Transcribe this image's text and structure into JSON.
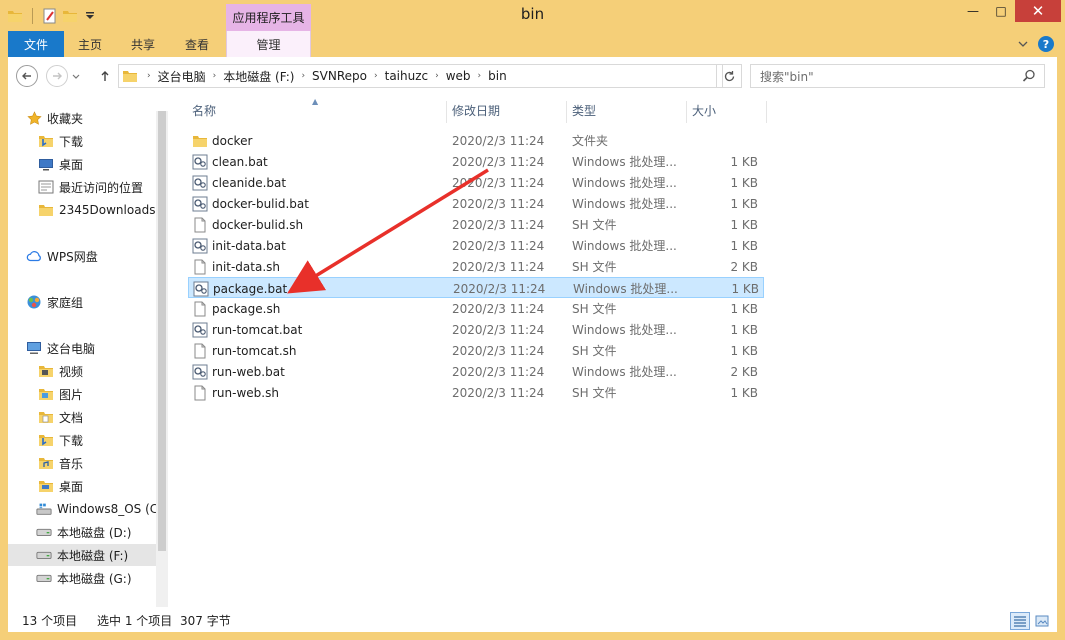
{
  "window": {
    "title": "bin",
    "tool_header": "应用程序工具",
    "close_glyph": "✕",
    "minimize_glyph": "—",
    "maximize_glyph": "□"
  },
  "ribbon": {
    "tabs": [
      "文件",
      "主页",
      "共享",
      "查看",
      "管理"
    ],
    "help": "?"
  },
  "address": {
    "crumbs": [
      "这台电脑",
      "本地磁盘 (F:)",
      "SVNRepo",
      "taihuzc",
      "web",
      "bin"
    ],
    "separator": "›"
  },
  "search": {
    "placeholder": "搜索\"bin\""
  },
  "sidebar": {
    "items": [
      {
        "label": "收藏夹",
        "icon": "star-icon"
      },
      {
        "label": "下载",
        "icon": "download-folder-icon"
      },
      {
        "label": "桌面",
        "icon": "desktop-icon"
      },
      {
        "label": "最近访问的位置",
        "icon": "recent-places-icon"
      },
      {
        "label": "2345Downloads",
        "icon": "folder-icon"
      },
      {
        "label": "WPS网盘",
        "icon": "cloud-icon"
      },
      {
        "label": "家庭组",
        "icon": "homegroup-icon"
      },
      {
        "label": "这台电脑",
        "icon": "computer-icon"
      },
      {
        "label": "视频",
        "icon": "videos-folder-icon"
      },
      {
        "label": "图片",
        "icon": "pictures-folder-icon"
      },
      {
        "label": "文档",
        "icon": "documents-folder-icon"
      },
      {
        "label": "下载",
        "icon": "download-folder-icon"
      },
      {
        "label": "音乐",
        "icon": "music-folder-icon"
      },
      {
        "label": "桌面",
        "icon": "desktop-folder-icon"
      },
      {
        "label": "Windows8_OS (C",
        "icon": "os-drive-icon"
      },
      {
        "label": "本地磁盘 (D:)",
        "icon": "drive-icon"
      },
      {
        "label": "本地磁盘 (F:)",
        "icon": "drive-icon"
      },
      {
        "label": "本地磁盘 (G:)",
        "icon": "drive-icon"
      }
    ]
  },
  "columns": {
    "name": "名称",
    "date": "修改日期",
    "type": "类型",
    "size": "大小"
  },
  "files": [
    {
      "name": "docker",
      "date": "2020/2/3 11:24",
      "type": "文件夹",
      "size": "",
      "icon": "folder-icon"
    },
    {
      "name": "clean.bat",
      "date": "2020/2/3 11:24",
      "type": "Windows 批处理...",
      "size": "1 KB",
      "icon": "bat-file-icon"
    },
    {
      "name": "cleanide.bat",
      "date": "2020/2/3 11:24",
      "type": "Windows 批处理...",
      "size": "1 KB",
      "icon": "bat-file-icon"
    },
    {
      "name": "docker-bulid.bat",
      "date": "2020/2/3 11:24",
      "type": "Windows 批处理...",
      "size": "1 KB",
      "icon": "bat-file-icon"
    },
    {
      "name": "docker-bulid.sh",
      "date": "2020/2/3 11:24",
      "type": "SH 文件",
      "size": "1 KB",
      "icon": "sh-file-icon"
    },
    {
      "name": "init-data.bat",
      "date": "2020/2/3 11:24",
      "type": "Windows 批处理...",
      "size": "1 KB",
      "icon": "bat-file-icon"
    },
    {
      "name": "init-data.sh",
      "date": "2020/2/3 11:24",
      "type": "SH 文件",
      "size": "2 KB",
      "icon": "sh-file-icon"
    },
    {
      "name": "package.bat",
      "date": "2020/2/3 11:24",
      "type": "Windows 批处理...",
      "size": "1 KB",
      "icon": "bat-file-icon"
    },
    {
      "name": "package.sh",
      "date": "2020/2/3 11:24",
      "type": "SH 文件",
      "size": "1 KB",
      "icon": "sh-file-icon"
    },
    {
      "name": "run-tomcat.bat",
      "date": "2020/2/3 11:24",
      "type": "Windows 批处理...",
      "size": "1 KB",
      "icon": "bat-file-icon"
    },
    {
      "name": "run-tomcat.sh",
      "date": "2020/2/3 11:24",
      "type": "SH 文件",
      "size": "1 KB",
      "icon": "sh-file-icon"
    },
    {
      "name": "run-web.bat",
      "date": "2020/2/3 11:24",
      "type": "Windows 批处理...",
      "size": "2 KB",
      "icon": "bat-file-icon"
    },
    {
      "name": "run-web.sh",
      "date": "2020/2/3 11:24",
      "type": "SH 文件",
      "size": "1 KB",
      "icon": "sh-file-icon"
    }
  ],
  "selected_file": "package.bat",
  "status": {
    "count": "13 个项目",
    "selection": "选中 1 个项目",
    "selection_size": "307 字节"
  },
  "colors": {
    "frame": "#f5cf78",
    "file_tab": "#1979ca",
    "tool_header": "#e6b4e6",
    "selection": "#cce8ff",
    "annotation_arrow": "#e8302a"
  }
}
